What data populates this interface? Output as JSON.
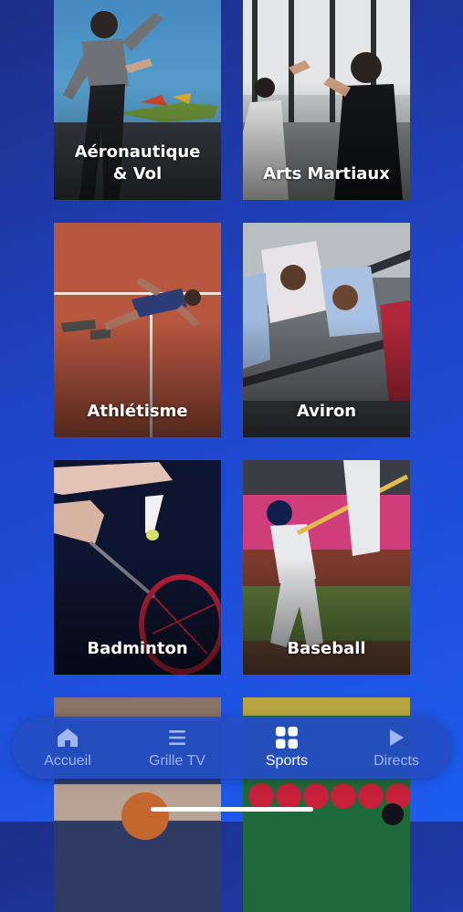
{
  "tiles": [
    {
      "label": "Aéronautique\n& Vol"
    },
    {
      "label": "Arts Martiaux"
    },
    {
      "label": "Athlétisme"
    },
    {
      "label": "Aviron"
    },
    {
      "label": "Badminton"
    },
    {
      "label": "Baseball"
    },
    {
      "label": ""
    },
    {
      "label": ""
    }
  ],
  "tabbar": {
    "tabs": [
      {
        "label": "Accueil",
        "icon": "home-icon",
        "active": false
      },
      {
        "label": "Grille TV",
        "icon": "list-icon",
        "active": false
      },
      {
        "label": "Sports",
        "icon": "grid-icon",
        "active": true
      },
      {
        "label": "Directs",
        "icon": "play-icon",
        "active": false
      }
    ],
    "active_color": "#ffffff",
    "inactive_color": "#9fb6ef"
  }
}
